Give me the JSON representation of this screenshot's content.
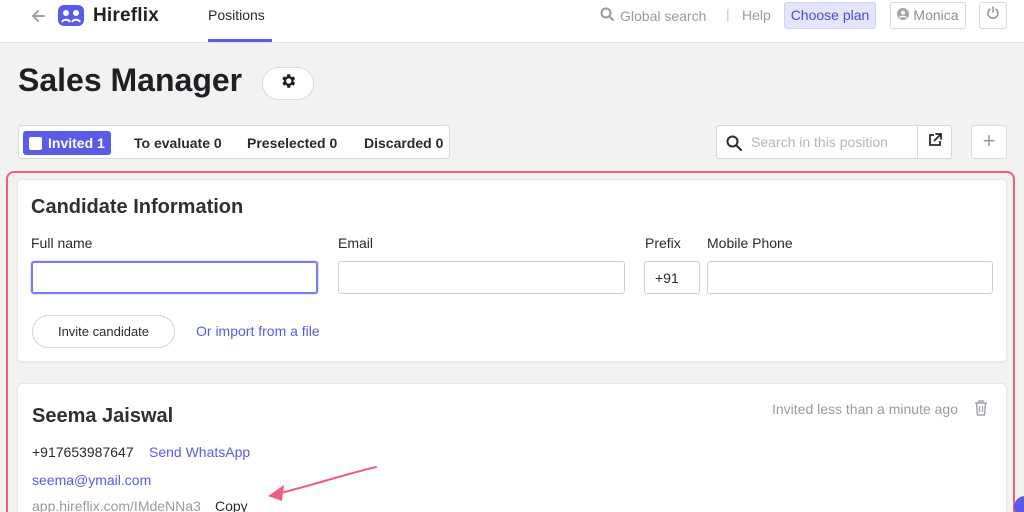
{
  "header": {
    "brand": "Hireflix",
    "nav_positions": "Positions",
    "global_search": "Global search",
    "divider": "|",
    "help": "Help",
    "choose_plan": "Choose plan",
    "user": "Monica"
  },
  "title": "Sales Manager",
  "tabs": [
    {
      "label": "Invited 1",
      "active": true
    },
    {
      "label": "To evaluate 0",
      "active": false
    },
    {
      "label": "Preselected 0",
      "active": false
    },
    {
      "label": "Discarded 0",
      "active": false
    }
  ],
  "search": {
    "placeholder": "Search in this position"
  },
  "add_label": "+",
  "candidate_form": {
    "title": "Candidate Information",
    "full_name_label": "Full name",
    "full_name_value": "",
    "email_label": "Email",
    "email_value": "",
    "prefix_label": "Prefix",
    "prefix_value": "+91",
    "phone_label": "Mobile Phone",
    "phone_value": "",
    "invite_button": "Invite candidate",
    "import_link": "Or import from a file"
  },
  "candidate": {
    "name": "Seema Jaiswal",
    "invited_time": "Invited less than a minute ago",
    "phone": "+917653987647",
    "send_whatsapp": "Send WhatsApp",
    "email": "seema@ymail.com",
    "interview_link": "app.hireflix.com/IMdeNNa3",
    "copy": "Copy"
  },
  "colors": {
    "accent": "#5b5be8",
    "highlight_frame": "#ec5f7d",
    "link": "#5a5ae0"
  }
}
